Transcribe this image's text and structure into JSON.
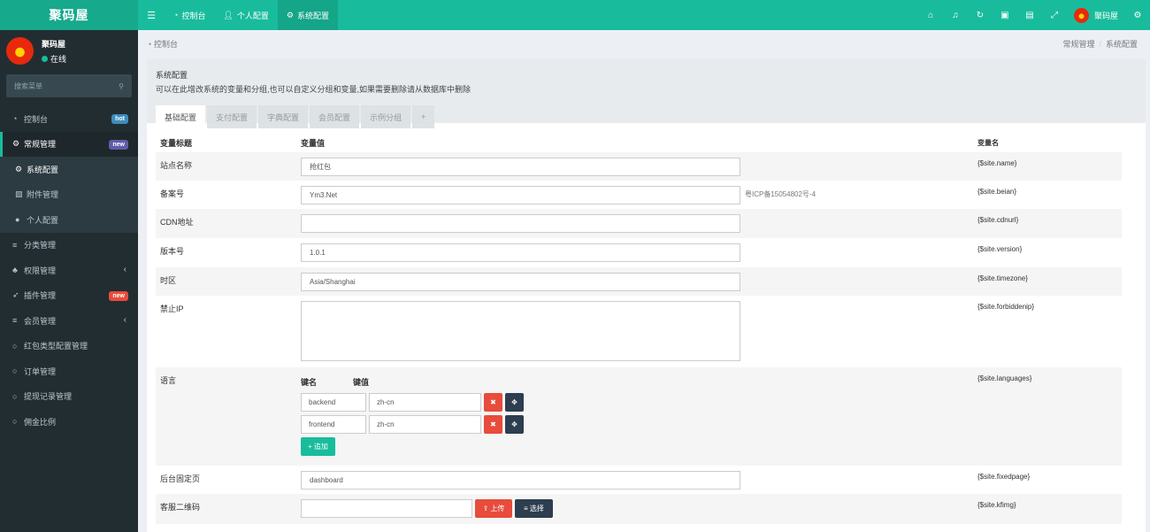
{
  "brand": "聚码屋",
  "topnav": [
    {
      "icon": "dashboard-icon",
      "label": "控制台"
    },
    {
      "icon": "user-icon",
      "label": "个人配置"
    },
    {
      "icon": "gear-icon",
      "label": "系统配置"
    }
  ],
  "topright": {
    "icons": [
      "home-icon",
      "bell-icon",
      "refresh-icon",
      "trash-icon",
      "language-icon",
      "fullscreen-icon"
    ],
    "username": "聚码屋",
    "settings_icon": "cogs-icon"
  },
  "user": {
    "name": "聚码屋",
    "status": "在线"
  },
  "search": {
    "placeholder": "搜索菜单"
  },
  "menu": [
    {
      "label": "控制台",
      "icon": "dashboard-icon",
      "badge": "hot",
      "badge_color": "#3c8dbc"
    },
    {
      "label": "常规管理",
      "icon": "cogs-icon",
      "badge": "new",
      "badge_color": "#605ca8",
      "active": true
    },
    {
      "label": "系统配置",
      "icon": "gear-icon",
      "sub": true,
      "on": true
    },
    {
      "label": "附件管理",
      "icon": "file-image-icon",
      "sub": true
    },
    {
      "label": "个人配置",
      "icon": "user-icon",
      "sub": true
    },
    {
      "label": "分类管理",
      "icon": "list-icon"
    },
    {
      "label": "权限管理",
      "icon": "group-icon",
      "caret": true
    },
    {
      "label": "插件管理",
      "icon": "rocket-icon",
      "badge": "new",
      "badge_color": "#e74c3c"
    },
    {
      "label": "会员管理",
      "icon": "list-icon",
      "caret": true
    },
    {
      "label": "红包类型配置管理",
      "icon": "circle-icon"
    },
    {
      "label": "订单管理",
      "icon": "circle-icon"
    },
    {
      "label": "提现记录管理",
      "icon": "circle-icon"
    },
    {
      "label": "佣金比例",
      "icon": "circle-icon"
    }
  ],
  "breadcrumb": {
    "left": "控制台",
    "right": [
      "常规管理",
      "系统配置"
    ]
  },
  "panel": {
    "title": "系统配置",
    "desc": "可以在此增改系统的变量和分组,也可以自定义分组和变量,如果需要删除请从数据库中删除"
  },
  "tabs": [
    "基础配置",
    "支付配置",
    "字典配置",
    "会员配置",
    "示例分组",
    "+"
  ],
  "table": {
    "headers": [
      "变量标题",
      "变量值",
      "变量名"
    ],
    "rows": [
      {
        "title": "站点名称",
        "value": "抢红包",
        "tip": "",
        "name": "{$site.name}"
      },
      {
        "title": "备案号",
        "value": "Ym3.Net",
        "tip": "粤ICP备15054802号-4",
        "name": "{$site.beian}"
      },
      {
        "title": "CDN地址",
        "value": "",
        "tip": "",
        "name": "{$site.cdnurl}"
      },
      {
        "title": "版本号",
        "value": "1.0.1",
        "tip": "",
        "name": "{$site.version}"
      },
      {
        "title": "时区",
        "value": "Asia/Shanghai",
        "tip": "",
        "name": "{$site.timezone}"
      },
      {
        "title": "禁止IP",
        "value": "",
        "tip": "",
        "name": "{$site.forbiddenip}"
      },
      {
        "title": "语言",
        "name": "{$site.languages}",
        "kv_headers": [
          "键名",
          "键值"
        ],
        "kv": [
          {
            "k": "backend",
            "v": "zh-cn"
          },
          {
            "k": "frontend",
            "v": "zh-cn"
          }
        ],
        "add_label": "追加"
      },
      {
        "title": "后台固定页",
        "value": "dashboard",
        "tip": "",
        "name": "{$site.fixedpage}"
      },
      {
        "title": "客服二维码",
        "value": "",
        "upload_label": "上传",
        "select_label": "选择",
        "name": "{$site.kfimg}"
      }
    ]
  }
}
